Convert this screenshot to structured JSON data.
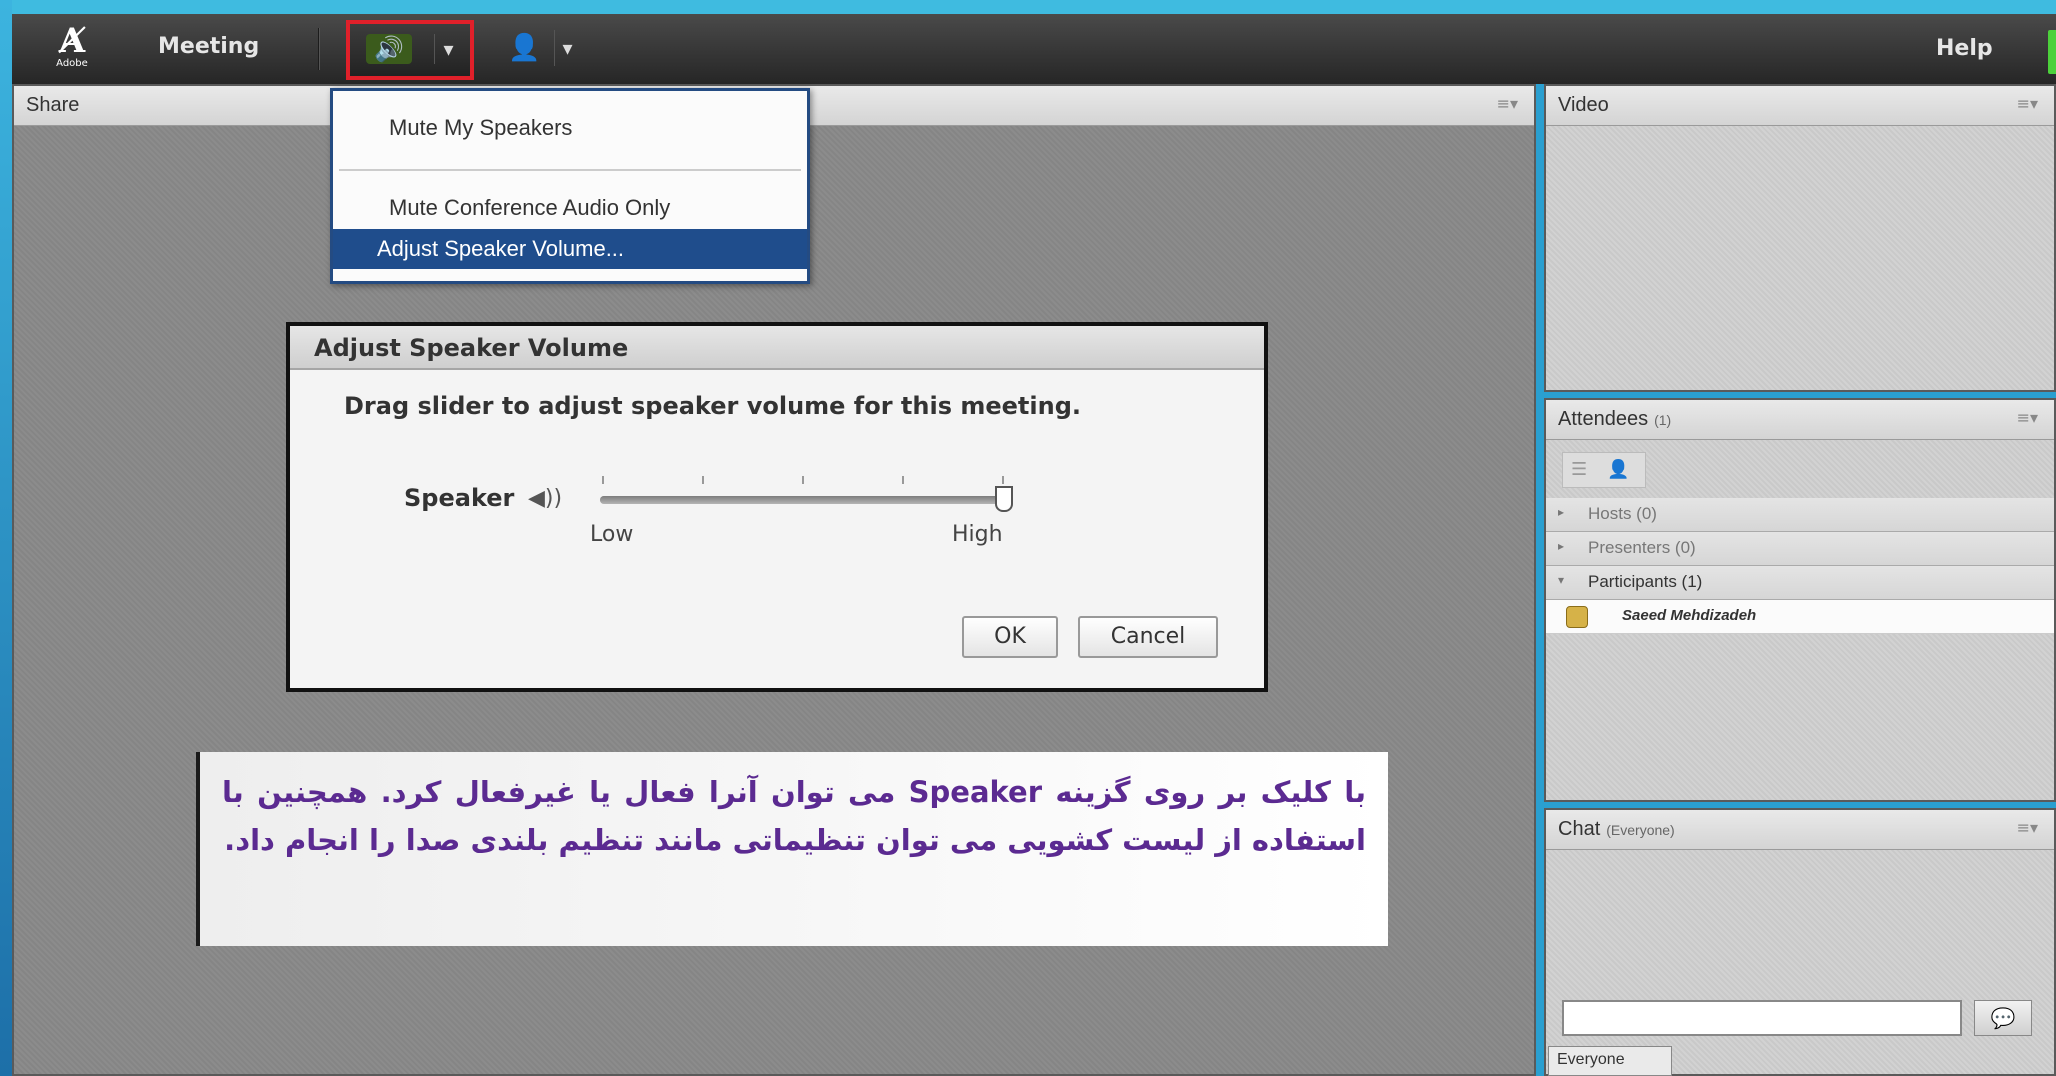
{
  "menubar": {
    "logo_text": "Adobe",
    "meeting_label": "Meeting",
    "help_label": "Help"
  },
  "pods": {
    "share_title": "Share",
    "video_title": "Video",
    "attendees_title": "Attendees",
    "attendees_count": "(1)",
    "chat_title": "Chat",
    "chat_scope": "(Everyone)"
  },
  "attendees": {
    "hosts": "Hosts (0)",
    "presenters": "Presenters (0)",
    "participants": "Participants (1)",
    "person": "Saeed Mehdizadeh"
  },
  "chat": {
    "input_value": "",
    "tab_label": "Everyone"
  },
  "dropdown": {
    "mute_speakers": "Mute My Speakers",
    "mute_conference": "Mute Conference Audio Only",
    "adjust_volume": "Adjust Speaker Volume..."
  },
  "dialog": {
    "title": "Adjust Speaker Volume",
    "message": "Drag slider to adjust speaker volume for this meeting.",
    "speaker_label": "Speaker",
    "low_label": "Low",
    "high_label": "High",
    "volume_level": 1.0,
    "ok_label": "OK",
    "cancel_label": "Cancel"
  },
  "callout": {
    "text": "با کلیک بر روی گزینه Speaker می توان آنرا فعال یا غیرفعال کرد. همچنین با استفاده از لیست کشویی می توان تنظیماتی مانند تنظیم بلندی صدا را انجام داد."
  },
  "colors": {
    "accent": "#1f4d8c",
    "highlight_border": "#e0202a",
    "callout_text": "#5b2a91"
  }
}
